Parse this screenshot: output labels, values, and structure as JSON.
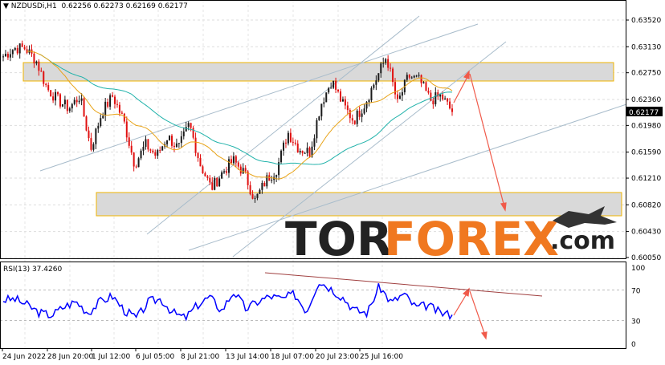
{
  "header": {
    "symbol_label": "NZDUSDi,H1",
    "ohlc": "0.62256 0.62273 0.62169 0.62177"
  },
  "logo": {
    "text_dark": "TOR",
    "text_orange": "FOREX",
    "text_suffix": ".com"
  },
  "colors": {
    "bull": "#1a1a1a",
    "bear": "#e01010",
    "ma_fast": "#e8a317",
    "ma_slow": "#20b2aa",
    "rsi": "#0000ff",
    "zone_fill": "#d9d9d9",
    "zone_border": "#f0b400",
    "channel": "#a8bccb",
    "arrow": "#f05a4a",
    "rsi_trend": "#a04040",
    "price_tag_bg": "#000000"
  },
  "chart_data": [
    {
      "type": "candlestick",
      "title": "NZDUSDi,H1",
      "ylim": [
        0.6005,
        0.6352
      ],
      "y_ticks": [
        "0.63520",
        "0.63130",
        "0.62750",
        "0.62360",
        "0.61980",
        "0.61590",
        "0.61210",
        "0.60820",
        "0.60430",
        "0.60050"
      ],
      "y_tick_values": [
        0.6352,
        0.6313,
        0.6275,
        0.6236,
        0.6198,
        0.6159,
        0.6121,
        0.6082,
        0.6043,
        0.6005
      ],
      "last_price": "0.62177",
      "x_ticks": [
        "24 Jun 2022",
        "28 Jun 20:00",
        "1 Jul 12:00",
        "6 Jul 05:00",
        "8 Jul 21:00",
        "13 Jul 14:00",
        "18 Jul 07:00",
        "20 Jul 23:00",
        "25 Jul 16:00"
      ],
      "closes_approx": [
        0.6299,
        0.6311,
        0.6311,
        0.6293,
        0.6252,
        0.6235,
        0.6223,
        0.6241,
        0.6164,
        0.6217,
        0.6241,
        0.6205,
        0.6141,
        0.617,
        0.6153,
        0.6182,
        0.6164,
        0.62,
        0.6141,
        0.6106,
        0.6129,
        0.6147,
        0.6129,
        0.6088,
        0.6118,
        0.6135,
        0.6188,
        0.6164,
        0.6159,
        0.6229,
        0.6264,
        0.6229,
        0.6205,
        0.6229,
        0.6264,
        0.6299,
        0.6229,
        0.627,
        0.6264,
        0.6235,
        0.6241,
        0.62177
      ],
      "indicators": [
        "Moving average (fast)",
        "Moving average (slow)"
      ]
    },
    {
      "type": "line",
      "title": "RSI(13) 37.4260",
      "ylim": [
        0,
        100
      ],
      "y_ticks": [
        "100",
        "70",
        "30",
        "0"
      ],
      "levels": [
        70,
        30
      ],
      "values_approx": [
        57,
        58,
        50,
        40,
        37,
        48,
        55,
        40,
        55,
        62,
        43,
        33,
        55,
        58,
        40,
        33,
        50,
        61,
        43,
        68,
        45,
        55,
        62,
        58,
        65,
        42,
        82,
        72,
        60,
        43,
        40,
        75,
        53,
        65,
        47,
        50,
        40,
        37.426
      ]
    }
  ]
}
